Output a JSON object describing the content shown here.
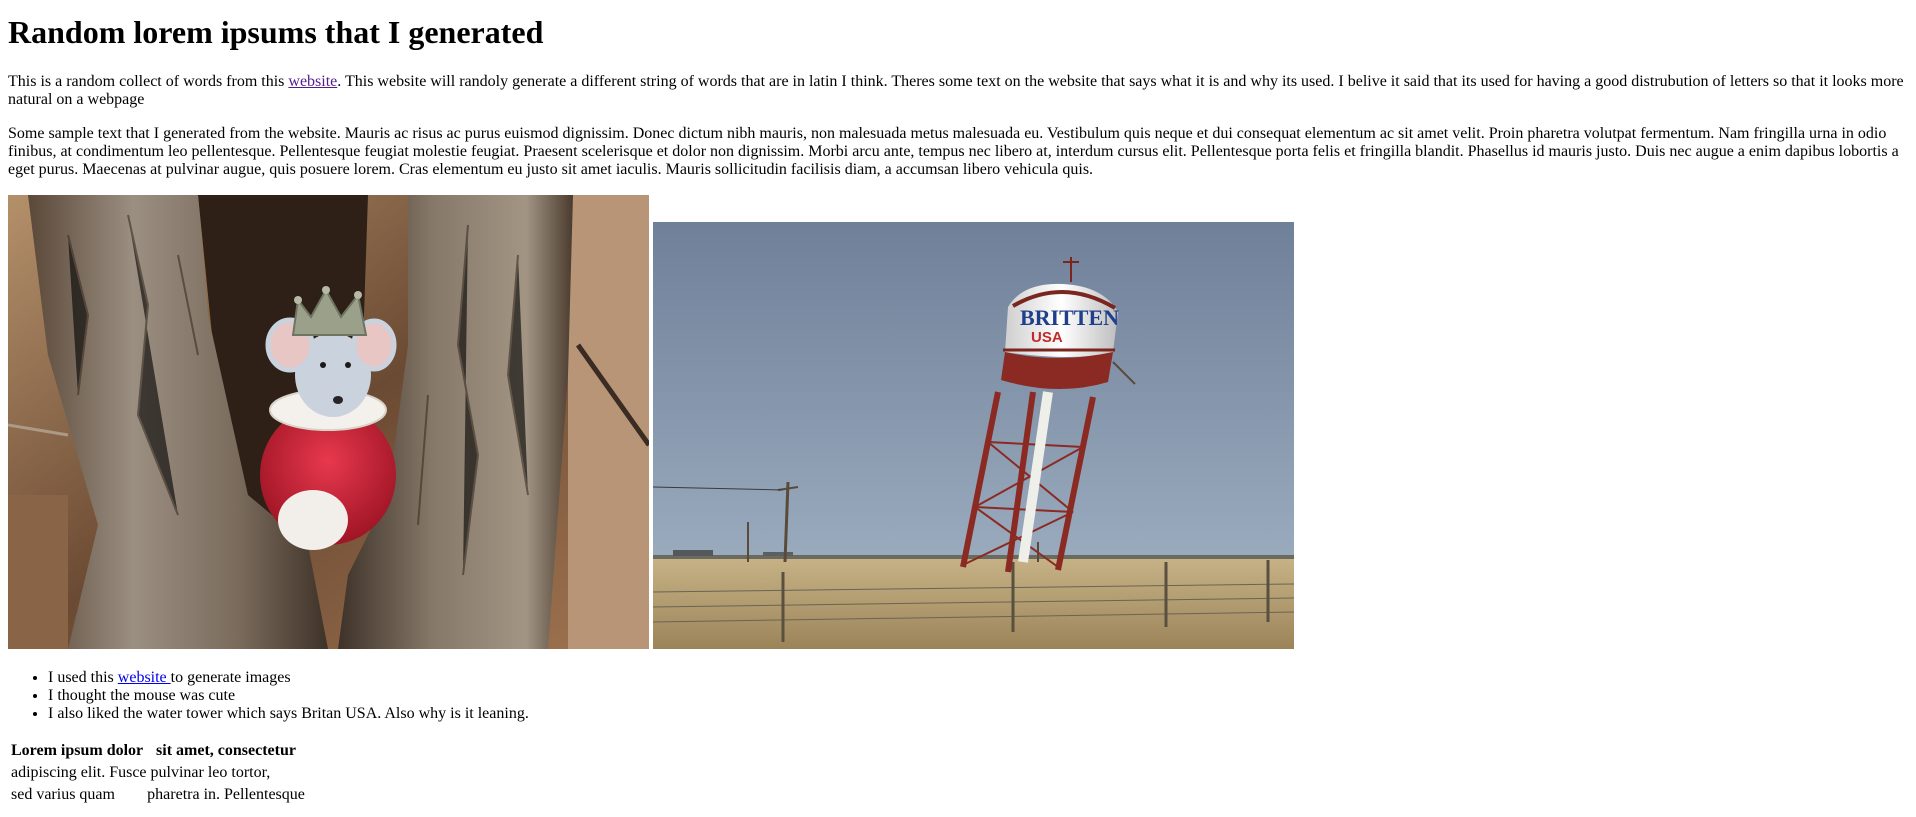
{
  "page": {
    "title": "Random lorem ipsums that I generated",
    "intro": {
      "before_link": "This is a random collect of words from this ",
      "link_text": "website",
      "after_link": ". This website will randoly generate a different string of words that are in latin I think. Theres some text on the website that says what it is and why its used. I belive it said that its used for having a good distrubution of letters so that it looks more natural on a webpage"
    },
    "sample": "Some sample text that I generated from the website. Mauris ac risus ac purus euismod dignissim. Donec dictum nibh mauris, non malesuada metus malesuada eu. Vestibulum quis neque et dui consequat elementum ac sit amet velit. Proin pharetra volutpat fermentum. Nam fringilla urna in odio finibus, at condimentum leo pellentesque. Pellentesque feugiat molestie feugiat. Praesent scelerisque et dolor non dignissim. Morbi arcu ante, tempus nec libero at, interdum cursus elit. Pellentesque porta felis et fringilla blandit. Phasellus id mauris justo. Duis nec augue a enim dapibus lobortis a eget purus. Maecenas at pulvinar augue, quis posuere lorem. Cras elementum eu justo sit amet iaculis. Mauris sollicitudin facilisis diam, a accumsan libero vehicula quis.",
    "images": {
      "tower_sign_line1": "BRITTEN",
      "tower_sign_line2": "USA"
    },
    "bullets": {
      "item1_before": "I used this ",
      "item1_link": "website ",
      "item1_after": "to generate images",
      "item2": "I thought the mouse was cute",
      "item3": "I also liked the water tower which says Britan USA. Also why is it leaning."
    },
    "table": {
      "headers": [
        "Lorem ipsum dolor",
        "sit amet, consectetur"
      ],
      "rows": [
        [
          "adipiscing elit. Fusce pulvinar leo tortor,",
          ""
        ],
        [
          "sed varius quam",
          "pharetra in. Pellentesque"
        ]
      ]
    }
  },
  "colors": {
    "link_visited": "#551a8b",
    "link_unvisited": "#0000ee",
    "sky": "#7d8fa6",
    "field": "#b89f6e",
    "tower_red": "#8b2a22"
  }
}
